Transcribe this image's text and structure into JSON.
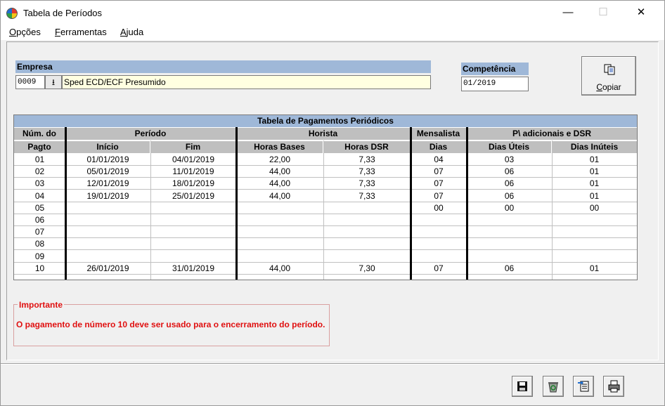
{
  "window": {
    "title": "Tabela de Períodos"
  },
  "window_controls": {
    "minimize": "—",
    "maximize": "☐",
    "close": "✕"
  },
  "menu": [
    {
      "label": "Opções",
      "u": "O",
      "rest": "pções"
    },
    {
      "label": "Ferramentas",
      "u": "F",
      "rest": "erramentas"
    },
    {
      "label": "Ajuda",
      "u": "A",
      "rest": "juda"
    }
  ],
  "empresa": {
    "label": "Empresa",
    "code": "0009",
    "name": "Sped ECD/ECF Presumido"
  },
  "competencia": {
    "label": "Competência",
    "value": "01/2019"
  },
  "copy_button": {
    "label": "Copiar",
    "icon": "copy-icon"
  },
  "grid": {
    "title": "Tabela de Pagamentos Periódicos",
    "group_headers": [
      "Núm. do",
      "Período",
      "Horista",
      "Mensalista",
      "P\\ adicionais e DSR"
    ],
    "columns": [
      "Pagto",
      "Início",
      "Fim",
      "Horas Bases",
      "Horas DSR",
      "Dias",
      "Dias Úteis",
      "Dias Inúteis"
    ],
    "rows": [
      [
        "01",
        "01/01/2019",
        "04/01/2019",
        "22,00",
        "7,33",
        "04",
        "03",
        "01"
      ],
      [
        "02",
        "05/01/2019",
        "11/01/2019",
        "44,00",
        "7,33",
        "07",
        "06",
        "01"
      ],
      [
        "03",
        "12/01/2019",
        "18/01/2019",
        "44,00",
        "7,33",
        "07",
        "06",
        "01"
      ],
      [
        "04",
        "19/01/2019",
        "25/01/2019",
        "44,00",
        "7,33",
        "07",
        "06",
        "01"
      ],
      [
        "05",
        "",
        "",
        "",
        "",
        "00",
        "00",
        "00"
      ],
      [
        "06",
        "",
        "",
        "",
        "",
        "",
        "",
        ""
      ],
      [
        "07",
        "",
        "",
        "",
        "",
        "",
        "",
        ""
      ],
      [
        "08",
        "",
        "",
        "",
        "",
        "",
        "",
        ""
      ],
      [
        "09",
        "",
        "",
        "",
        "",
        "",
        "",
        ""
      ],
      [
        "10",
        "26/01/2019",
        "31/01/2019",
        "44,00",
        "7,30",
        "07",
        "06",
        "01"
      ]
    ]
  },
  "important": {
    "legend": "Importante",
    "text": "O pagamento de número 10 deve ser usado para o encerramento do período."
  },
  "toolbar": [
    {
      "name": "save-button",
      "icon": "floppy-disk-icon",
      "glyph": "💾"
    },
    {
      "name": "delete-button",
      "icon": "recycle-bin-icon",
      "glyph": "♻"
    },
    {
      "name": "import-button",
      "icon": "import-document-icon",
      "glyph": "📄"
    },
    {
      "name": "print-button",
      "icon": "printer-icon",
      "glyph": "🖶"
    }
  ]
}
